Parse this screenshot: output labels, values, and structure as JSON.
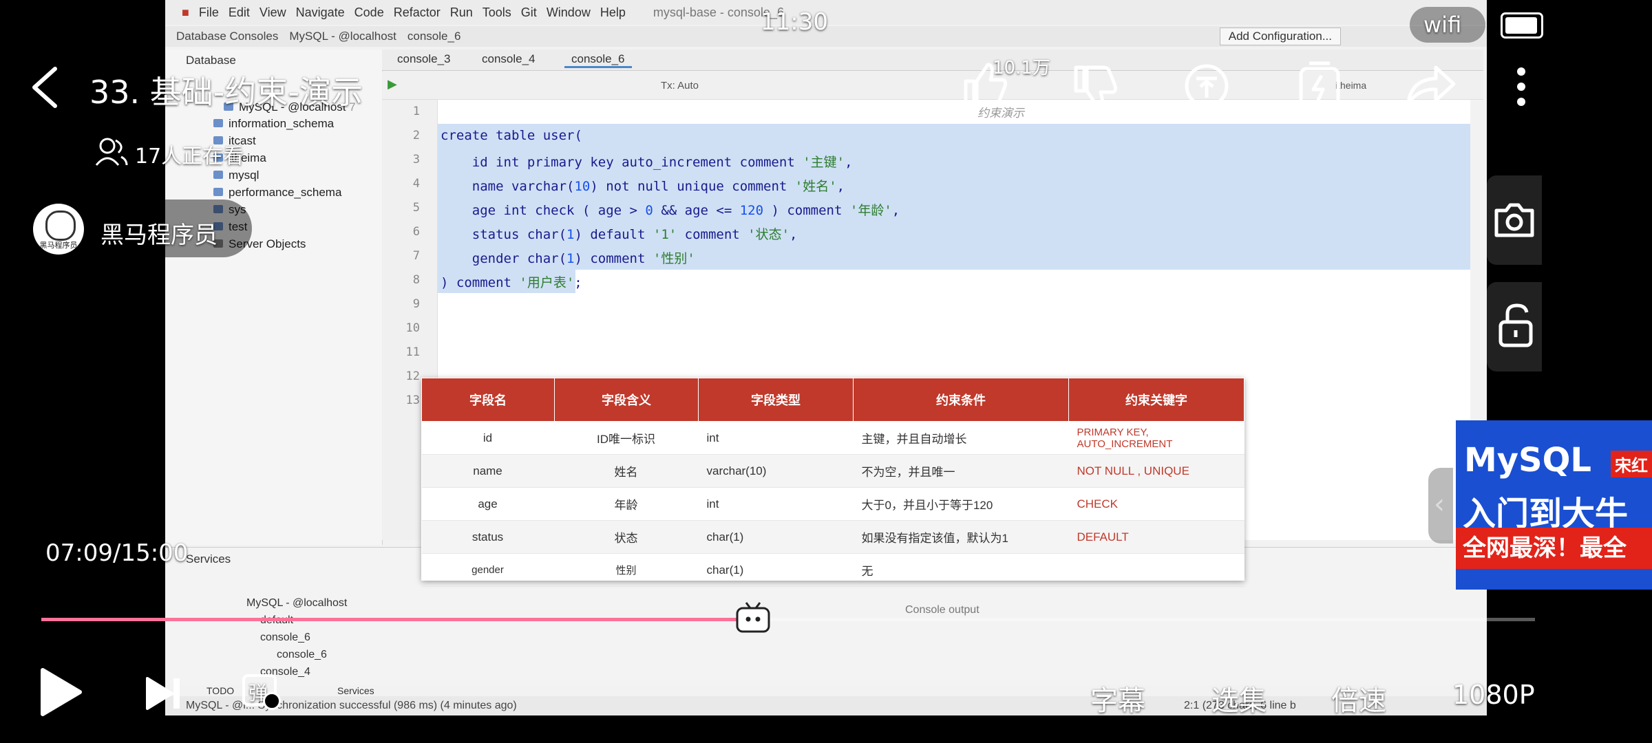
{
  "status_bar": {
    "time": "11:30",
    "wifi": "wifi"
  },
  "video": {
    "title": "33. 基础-约束-演示",
    "viewers": "17人正在看",
    "uploader": "黑马程序员",
    "uploader_avatar_text": "黑马程序员",
    "like_count": "10.1万",
    "time": "07:09/15:00",
    "progress": 0.4767
  },
  "controls": {
    "subtitle": "字幕",
    "episodes": "选集",
    "speed": "倍速",
    "quality": "1080P",
    "danmaku_icon": "弹"
  },
  "ad": {
    "line1": "MySQL",
    "tag": "宋红",
    "line2": "入门到大牛",
    "line3": "全网最深！最全"
  },
  "ide": {
    "menu": [
      "File",
      "Edit",
      "View",
      "Navigate",
      "Code",
      "Refactor",
      "Run",
      "Tools",
      "Git",
      "Window",
      "Help"
    ],
    "window_title": "mysql-base - console_6",
    "breadcrumbs": [
      "Database Consoles",
      "MySQL - @localhost",
      "console_6"
    ],
    "add_config": "Add Configuration...",
    "db_panel_title": "Database",
    "tree": {
      "root": "MySQL - @localhost",
      "root_count": "7",
      "schemas": [
        "information_schema",
        "itcast",
        "itheima",
        "mysql",
        "performance_schema",
        "sys",
        "test"
      ],
      "server_objects": "Server Objects"
    },
    "tabs": [
      "console_3",
      "console_4",
      "console_6"
    ],
    "tx_mode": "Tx: Auto",
    "schema_selector": "itheima",
    "section_comment": "约束演示",
    "line_numbers": [
      "1",
      "2",
      "3",
      "4",
      "5",
      "6",
      "7",
      "8",
      "9",
      "10",
      "11",
      "12",
      "13"
    ],
    "code": {
      "l2": "create table user(",
      "l3a": "    id int primary key auto_increment comment ",
      "l3s": "'主键'",
      "l3e": ",",
      "l4a": "    name varchar(",
      "l4n": "10",
      "l4b": ") not null unique comment ",
      "l4s": "'姓名'",
      "l4e": ",",
      "l5a": "    age int check ( age > ",
      "l5n1": "0",
      "l5b": " && age <= ",
      "l5n2": "120",
      "l5c": " ) comment ",
      "l5s": "'年龄'",
      "l5e": ",",
      "l6a": "    status char(",
      "l6n": "1",
      "l6b": ") default ",
      "l6s1": "'1'",
      "l6c": " comment ",
      "l6s2": "'状态'",
      "l6e": ",",
      "l7a": "    gender char(",
      "l7n": "1",
      "l7b": ") comment ",
      "l7s": "'性别'",
      "l8a": ") comment ",
      "l8s": "'用户表'",
      "l8e": ";"
    },
    "services_label": "Services",
    "services_tree": [
      "MySQL - @localhost",
      "default",
      "console_6",
      "console_6",
      "console_4"
    ],
    "console_output": "Console output",
    "bottom_tabs": [
      "TODO",
      "Services"
    ],
    "status_text": "MySQL - @l... Synchronization successful (986 ms) (4 minutes ago)",
    "status_right": "2:1 (273 chars, 6 line b"
  },
  "constraint_table": {
    "headers": [
      "字段名",
      "字段含义",
      "字段类型",
      "约束条件",
      "约束关键字"
    ],
    "rows": [
      [
        "id",
        "ID唯一标识",
        "int",
        "主键，并且自动增长",
        "PRIMARY KEY, AUTO_INCREMENT"
      ],
      [
        "name",
        "姓名",
        "varchar(10)",
        "不为空，并且唯一",
        "NOT NULL , UNIQUE"
      ],
      [
        "age",
        "年龄",
        "int",
        "大于0，并且小于等于120",
        "CHECK"
      ],
      [
        "status",
        "状态",
        "char(1)",
        "如果没有指定该值，默认为1",
        "DEFAULT"
      ],
      [
        "gender",
        "性别",
        "char(1)",
        "无",
        ""
      ]
    ]
  },
  "colors": {
    "progress": "#fb7299",
    "header_red": "#c0392b",
    "selection": "#cfe0f5"
  }
}
